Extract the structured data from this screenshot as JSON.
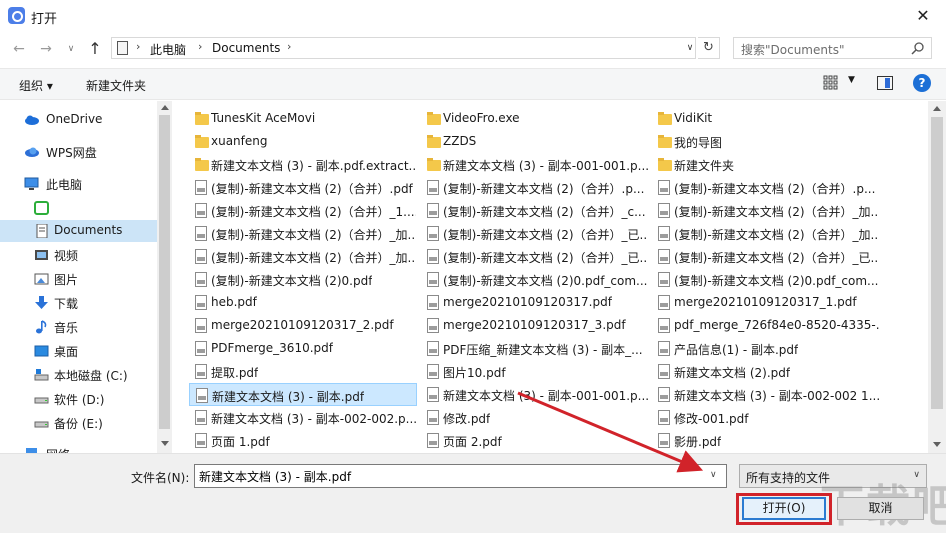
{
  "titlebar": {
    "title": "打开",
    "close": "✕"
  },
  "nav": {
    "back": "←",
    "forward": "→",
    "up": "↑",
    "breadcrumbs": [
      "此电脑",
      "Documents"
    ],
    "search_placeholder": "搜索\"Documents\""
  },
  "toolbar": {
    "organize": "组织 ▾",
    "new_folder": "新建文件夹",
    "help": "?"
  },
  "sidebar": {
    "items": [
      {
        "label": "OneDrive",
        "icon": "cloud-icon"
      },
      {
        "label": "WPS网盘",
        "icon": "wps-cloud-icon"
      },
      {
        "label": "此电脑",
        "icon": "computer-icon"
      },
      {
        "label": "",
        "icon": "green-app-icon"
      },
      {
        "label": "Documents",
        "icon": "documents-icon"
      },
      {
        "label": "视频",
        "icon": "video-icon"
      },
      {
        "label": "图片",
        "icon": "pictures-icon"
      },
      {
        "label": "下载",
        "icon": "download-icon"
      },
      {
        "label": "音乐",
        "icon": "music-icon"
      },
      {
        "label": "桌面",
        "icon": "desktop-icon"
      },
      {
        "label": "本地磁盘 (C:)",
        "icon": "drive-icon"
      },
      {
        "label": "软件 (D:)",
        "icon": "drive-icon"
      },
      {
        "label": "备份 (E:)",
        "icon": "drive-icon"
      },
      {
        "label": "网络",
        "icon": "network-icon"
      }
    ]
  },
  "files": [
    [
      "TunesKit AceMovi",
      "folder"
    ],
    [
      "VideoFro.exe",
      "folder"
    ],
    [
      "VidiKit",
      "folder"
    ],
    [
      "xuanfeng",
      "folder"
    ],
    [
      "ZZDS",
      "folder"
    ],
    [
      "我的导图",
      "folder"
    ],
    [
      "新建文本文档 (3) - 副本.pdf.extract...",
      "folder"
    ],
    [
      "新建文本文档 (3) - 副本-001-001.p...",
      "folder"
    ],
    [
      "新建文件夹",
      "folder"
    ],
    [
      "(复制)-新建文本文档 (2)（合并）.pdf",
      "pdf"
    ],
    [
      "(复制)-新建文本文档 (2)（合并）.p...",
      "pdf"
    ],
    [
      "(复制)-新建文本文档 (2)（合并）.p...",
      "pdf"
    ],
    [
      "(复制)-新建文本文档 (2)（合并）_1....",
      "pdf"
    ],
    [
      "(复制)-新建文本文档 (2)（合并）_c...",
      "pdf"
    ],
    [
      "(复制)-新建文本文档 (2)（合并）_加...",
      "pdf"
    ],
    [
      "(复制)-新建文本文档 (2)（合并）_加...",
      "pdf"
    ],
    [
      "(复制)-新建文本文档 (2)（合并）_已...",
      "pdf"
    ],
    [
      "(复制)-新建文本文档 (2)（合并）_加...",
      "pdf"
    ],
    [
      "(复制)-新建文本文档 (2)（合并）_加...",
      "pdf"
    ],
    [
      "(复制)-新建文本文档 (2)（合并）_已...",
      "pdf"
    ],
    [
      "(复制)-新建文本文档 (2)（合并）_已...",
      "pdf"
    ],
    [
      "(复制)-新建文本文档 (2)0.pdf",
      "pdf"
    ],
    [
      "(复制)-新建文本文档 (2)0.pdf_com...",
      "pdf"
    ],
    [
      "(复制)-新建文本文档 (2)0.pdf_com...",
      "pdf"
    ],
    [
      "heb.pdf",
      "pdf"
    ],
    [
      "merge20210109120317.pdf",
      "pdf"
    ],
    [
      "merge20210109120317_1.pdf",
      "pdf"
    ],
    [
      "merge20210109120317_2.pdf",
      "pdf"
    ],
    [
      "merge20210109120317_3.pdf",
      "pdf"
    ],
    [
      "pdf_merge_726f84e0-8520-4335-...",
      "pdf"
    ],
    [
      "PDFmerge_3610.pdf",
      "pdf"
    ],
    [
      "PDF压缩_新建文本文档 (3) - 副本_...",
      "pdf"
    ],
    [
      "产品信息(1) - 副本.pdf",
      "pdf"
    ],
    [
      "提取.pdf",
      "pdf"
    ],
    [
      "图片10.pdf",
      "pdf"
    ],
    [
      "新建文本文档 (2).pdf",
      "pdf"
    ],
    [
      "新建文本文档 (3) - 副本.pdf",
      "pdf"
    ],
    [
      "新建文本文档 (3) - 副本-001-001.p...",
      "pdf"
    ],
    [
      "新建文本文档 (3) - 副本-002-002 1...",
      "pdf"
    ],
    [
      "新建文本文档 (3) - 副本-002-002.p...",
      "pdf"
    ],
    [
      "修改.pdf",
      "pdf"
    ],
    [
      "修改-001.pdf",
      "pdf"
    ],
    [
      "页面 1.pdf",
      "pdf"
    ],
    [
      "页面 2.pdf",
      "pdf"
    ],
    [
      "影册.pdf",
      "pdf"
    ]
  ],
  "selected_file": "新建文本文档 (3) - 副本.pdf",
  "bottom": {
    "filename_label": "文件名(N):",
    "filename_value": "新建文本文档 (3) - 副本.pdf",
    "filter_value": "所有支持的文件",
    "open_label": "打开(O)",
    "cancel_label": "取消"
  },
  "accent_colors": {
    "highlight_red": "#d1232a",
    "selection": "#cce8ff"
  }
}
